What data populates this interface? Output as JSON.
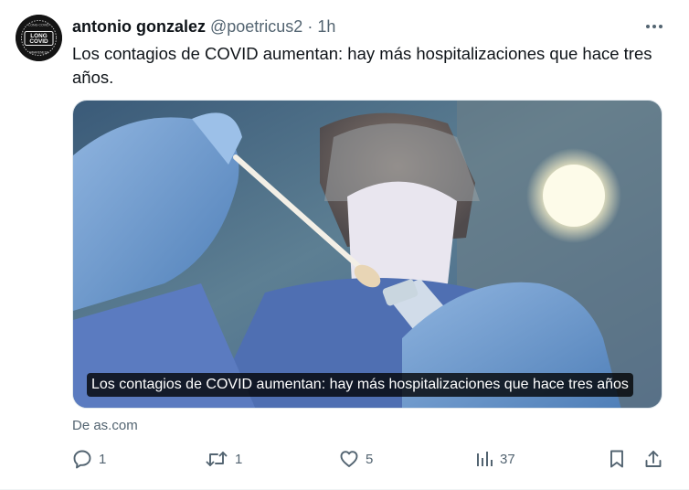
{
  "tweet": {
    "author_name": "antonio gonzalez",
    "handle": "@poetricus2",
    "separator": "·",
    "time": "1h",
    "text": "Los contagios de COVID aumentan: hay más hospitalizaciones que hace tres años.",
    "avatar_text": {
      "top": "LONG COVID",
      "line1": "LONG",
      "line2": "COVID",
      "bottom": "AWARENESS"
    }
  },
  "card": {
    "caption": "Los contagios de COVID aumentan: hay más hospitalizaciones que hace tres años",
    "source": "De as.com"
  },
  "actions": {
    "replies": "1",
    "retweets": "1",
    "likes": "5",
    "views": "37"
  },
  "icons": {
    "more": "more-icon",
    "reply": "reply-icon",
    "retweet": "retweet-icon",
    "like": "heart-icon",
    "views": "views-icon",
    "bookmark": "bookmark-icon",
    "share": "share-icon"
  },
  "colors": {
    "text": "#0f1419",
    "secondary": "#536471",
    "border": "#eff3f4"
  }
}
